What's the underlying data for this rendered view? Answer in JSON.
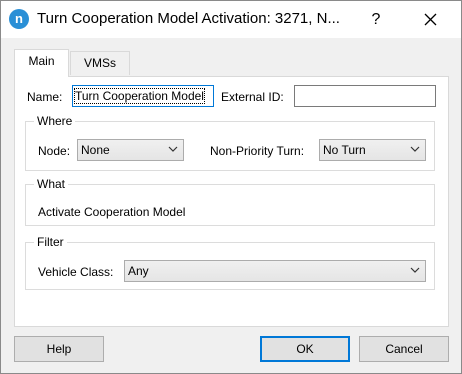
{
  "window": {
    "title": "Turn Cooperation Model Activation: 3271, N...",
    "app_icon_letter": "n",
    "help_glyph": "?"
  },
  "tabs": [
    {
      "label": "Main",
      "active": true
    },
    {
      "label": "VMSs",
      "active": false
    }
  ],
  "main": {
    "name_label": "Name:",
    "name_value": "Turn Cooperation Model",
    "external_id_label": "External ID:",
    "external_id_value": "",
    "where": {
      "title": "Where",
      "node_label": "Node:",
      "node_value": "None",
      "non_priority_turn_label": "Non-Priority Turn:",
      "non_priority_turn_value": "No Turn"
    },
    "what": {
      "title": "What",
      "text": "Activate Cooperation Model"
    },
    "filter": {
      "title": "Filter",
      "vehicle_class_label": "Vehicle Class:",
      "vehicle_class_value": "Any"
    }
  },
  "footer": {
    "help_label": "Help",
    "ok_label": "OK",
    "cancel_label": "Cancel"
  },
  "icons": [
    "app-logo-icon",
    "help-icon",
    "close-icon",
    "chevron-down-icon"
  ],
  "colors": {
    "accent": "#0078d7",
    "app_icon": "#2a8fd6"
  }
}
